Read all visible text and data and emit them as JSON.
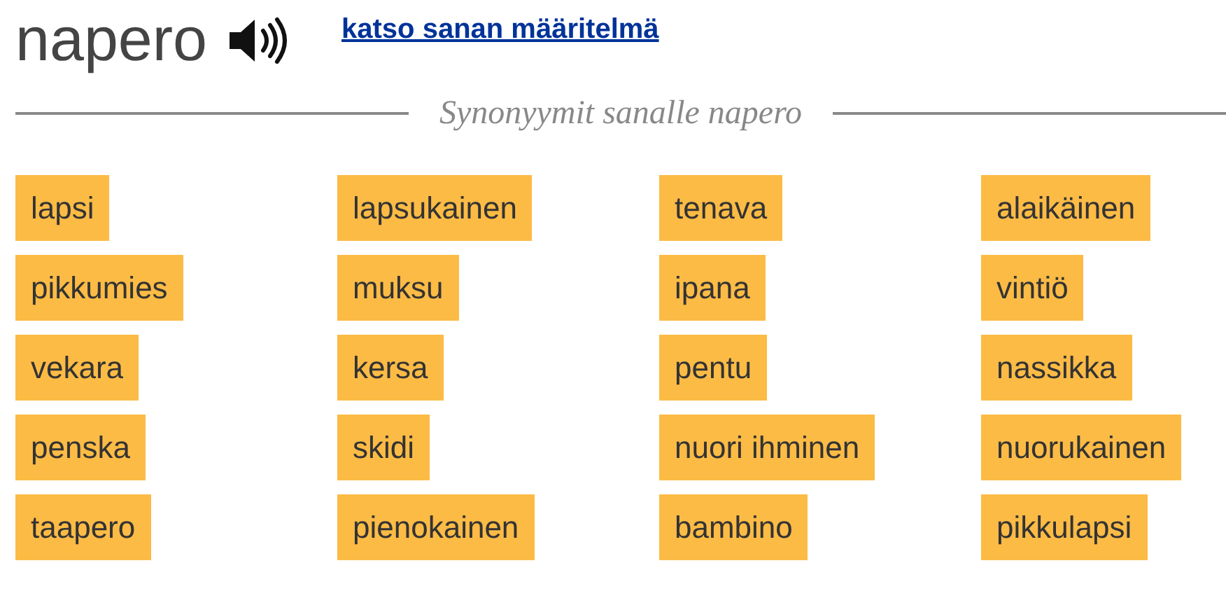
{
  "word": "napero",
  "definition_link": "katso sanan määritelmä",
  "section_heading": "Synonyymit sanalle napero",
  "synonyms": [
    "lapsi",
    "lapsukainen",
    "tenava",
    "alaikäinen",
    "pikkumies",
    "muksu",
    "ipana",
    "vintiö",
    "vekara",
    "kersa",
    "pentu",
    "nassikka",
    "penska",
    "skidi",
    "nuori ihminen",
    "nuorukainen",
    "taapero",
    "pienokainen",
    "bambino",
    "pikkulapsi"
  ]
}
